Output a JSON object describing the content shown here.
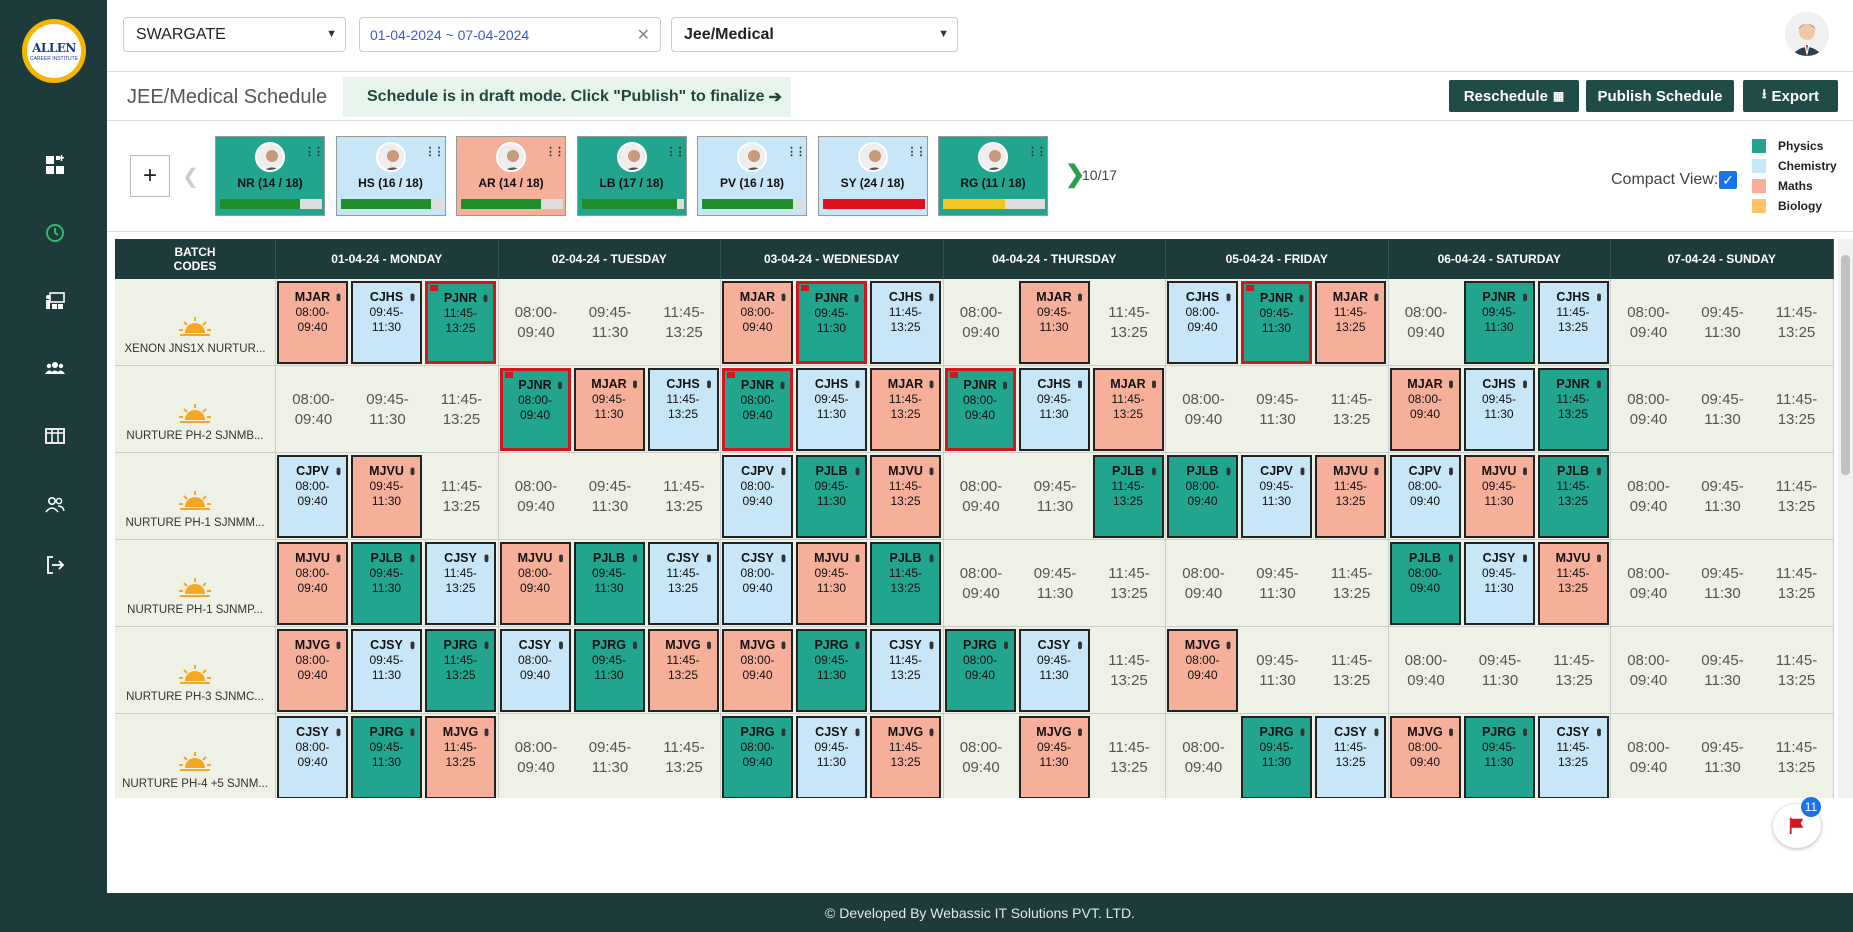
{
  "brand": {
    "logo_text": "ALLEN",
    "logo_sub": "CAREER INSTITUTE"
  },
  "sidebar": {
    "items": [
      {
        "name": "dashboard-icon",
        "active": false
      },
      {
        "name": "clock-icon",
        "active": true
      },
      {
        "name": "classroom-icon",
        "active": false
      },
      {
        "name": "group-icon",
        "active": false
      },
      {
        "name": "calendar-grid-icon",
        "active": false
      },
      {
        "name": "users-icon",
        "active": false
      },
      {
        "name": "logout-icon",
        "active": false
      }
    ]
  },
  "filters": {
    "center": "SWARGATE",
    "date_range": "01-04-2024 ~ 07-04-2024",
    "stream": "Jee/Medical"
  },
  "header": {
    "title": "JEE/Medical Schedule",
    "banner": "Schedule is in draft mode. Click \"Publish\" to finalize",
    "reschedule_label": "Reschedule",
    "publish_label": "Publish Schedule",
    "export_label": "Export"
  },
  "teachers": [
    {
      "initials": "NR",
      "count": "(14 / 18)",
      "subject": "Physics",
      "progress": 0.78,
      "bar_color": "#1e8f2a"
    },
    {
      "initials": "HS",
      "count": "(16 / 18)",
      "subject": "Chemistry",
      "progress": 0.89,
      "bar_color": "#1e8f2a"
    },
    {
      "initials": "AR",
      "count": "(14 / 18)",
      "subject": "Maths",
      "progress": 0.78,
      "bar_color": "#1e8f2a"
    },
    {
      "initials": "LB",
      "count": "(17 / 18)",
      "subject": "Physics",
      "progress": 0.94,
      "bar_color": "#1e8f2a"
    },
    {
      "initials": "PV",
      "count": "(16 / 18)",
      "subject": "Chemistry",
      "progress": 0.89,
      "bar_color": "#1e8f2a"
    },
    {
      "initials": "SY",
      "count": "(24 / 18)",
      "subject": "Chemistry",
      "progress": 1.0,
      "bar_color": "#e0111b"
    },
    {
      "initials": "RG",
      "count": "(11 / 18)",
      "subject": "Physics",
      "progress": 0.61,
      "bar_color": "#f3c623"
    }
  ],
  "pagination": {
    "text": "10/17"
  },
  "compact": {
    "label": "Compact View:",
    "checked": true
  },
  "legend": [
    {
      "label": "Physics",
      "color": "#22a58f"
    },
    {
      "label": "Chemistry",
      "color": "#c7e6f7"
    },
    {
      "label": "Maths",
      "color": "#f6b09a"
    },
    {
      "label": "Biology",
      "color": "#fcc36b"
    }
  ],
  "schedule": {
    "batch_header": "BATCH\nCODES",
    "days": [
      "01-04-24 - MONDAY",
      "02-04-24 - TUESDAY",
      "03-04-24 - WEDNESDAY",
      "04-04-24 - THURSDAY",
      "05-04-24 - FRIDAY",
      "06-04-24 - SATURDAY",
      "07-04-24 - SUNDAY"
    ],
    "slot_times": [
      "08:00-\n09:40",
      "09:45-\n11:30",
      "11:45-\n13:25"
    ],
    "batches": [
      {
        "name": "XENON JNS1X NURTUR...",
        "cells": [
          [
            [
              "MJAR",
              "Maths",
              0
            ],
            [
              "CJHS",
              "Chemistry",
              0
            ],
            [
              "PJNR",
              "Physics",
              1
            ]
          ],
          [
            null,
            null,
            null
          ],
          [
            [
              "MJAR",
              "Maths",
              0
            ],
            [
              "PJNR",
              "Physics",
              1
            ],
            [
              "CJHS",
              "Chemistry",
              0
            ]
          ],
          [
            null,
            [
              "MJAR",
              "Maths",
              0
            ],
            null
          ],
          [
            [
              "CJHS",
              "Chemistry",
              0
            ],
            [
              "PJNR",
              "Physics",
              1
            ],
            [
              "MJAR",
              "Maths",
              0
            ]
          ],
          [
            null,
            [
              "PJNR",
              "Physics",
              0
            ],
            [
              "CJHS",
              "Chemistry",
              0
            ]
          ],
          [
            null,
            null,
            null
          ]
        ]
      },
      {
        "name": "NURTURE PH-2 SJNMB...",
        "cells": [
          [
            null,
            null,
            null
          ],
          [
            [
              "PJNR",
              "Physics",
              1
            ],
            [
              "MJAR",
              "Maths",
              0
            ],
            [
              "CJHS",
              "Chemistry",
              0
            ]
          ],
          [
            [
              "PJNR",
              "Physics",
              1
            ],
            [
              "CJHS",
              "Chemistry",
              0
            ],
            [
              "MJAR",
              "Maths",
              0
            ]
          ],
          [
            [
              "PJNR",
              "Physics",
              1
            ],
            [
              "CJHS",
              "Chemistry",
              0
            ],
            [
              "MJAR",
              "Maths",
              0
            ]
          ],
          [
            null,
            null,
            null
          ],
          [
            [
              "MJAR",
              "Maths",
              0
            ],
            [
              "CJHS",
              "Chemistry",
              0
            ],
            [
              "PJNR",
              "Physics",
              0
            ]
          ],
          [
            null,
            null,
            null
          ]
        ]
      },
      {
        "name": "NURTURE PH-1 SJNMM...",
        "cells": [
          [
            [
              "CJPV",
              "Chemistry",
              0
            ],
            [
              "MJVU",
              "Maths",
              0
            ],
            null
          ],
          [
            null,
            null,
            null
          ],
          [
            [
              "CJPV",
              "Chemistry",
              0
            ],
            [
              "PJLB",
              "Physics",
              0
            ],
            [
              "MJVU",
              "Maths",
              0
            ]
          ],
          [
            null,
            null,
            [
              "PJLB",
              "Physics",
              0
            ]
          ],
          [
            [
              "PJLB",
              "Physics",
              0
            ],
            [
              "CJPV",
              "Chemistry",
              0
            ],
            [
              "MJVU",
              "Maths",
              0
            ]
          ],
          [
            [
              "CJPV",
              "Chemistry",
              0
            ],
            [
              "MJVU",
              "Maths",
              0
            ],
            [
              "PJLB",
              "Physics",
              0
            ]
          ],
          [
            null,
            null,
            null
          ]
        ]
      },
      {
        "name": "NURTURE PH-1 SJNMP...",
        "cells": [
          [
            [
              "MJVU",
              "Maths",
              0
            ],
            [
              "PJLB",
              "Physics",
              0
            ],
            [
              "CJSY",
              "Chemistry",
              0
            ]
          ],
          [
            [
              "MJVU",
              "Maths",
              0
            ],
            [
              "PJLB",
              "Physics",
              0
            ],
            [
              "CJSY",
              "Chemistry",
              0
            ]
          ],
          [
            [
              "CJSY",
              "Chemistry",
              0
            ],
            [
              "MJVU",
              "Maths",
              0
            ],
            [
              "PJLB",
              "Physics",
              0
            ]
          ],
          [
            null,
            null,
            null
          ],
          [
            null,
            null,
            null
          ],
          [
            [
              "PJLB",
              "Physics",
              0
            ],
            [
              "CJSY",
              "Chemistry",
              0
            ],
            [
              "MJVU",
              "Maths",
              0
            ]
          ],
          [
            null,
            null,
            null
          ]
        ]
      },
      {
        "name": "NURTURE PH-3 SJNMC...",
        "cells": [
          [
            [
              "MJVG",
              "Maths",
              0
            ],
            [
              "CJSY",
              "Chemistry",
              0
            ],
            [
              "PJRG",
              "Physics",
              0
            ]
          ],
          [
            [
              "CJSY",
              "Chemistry",
              0
            ],
            [
              "PJRG",
              "Physics",
              0
            ],
            [
              "MJVG",
              "Maths",
              0
            ]
          ],
          [
            [
              "MJVG",
              "Maths",
              0
            ],
            [
              "PJRG",
              "Physics",
              0
            ],
            [
              "CJSY",
              "Chemistry",
              0
            ]
          ],
          [
            [
              "PJRG",
              "Physics",
              0
            ],
            [
              "CJSY",
              "Chemistry",
              0
            ],
            null
          ],
          [
            [
              "MJVG",
              "Maths",
              0
            ],
            null,
            null
          ],
          [
            null,
            null,
            null
          ],
          [
            null,
            null,
            null
          ]
        ]
      },
      {
        "name": "NURTURE PH-4 +5 SJNM...",
        "cells": [
          [
            [
              "CJSY",
              "Chemistry",
              0
            ],
            [
              "PJRG",
              "Physics",
              0
            ],
            [
              "MJVG",
              "Maths",
              0
            ]
          ],
          [
            null,
            null,
            null
          ],
          [
            [
              "PJRG",
              "Physics",
              0
            ],
            [
              "CJSY",
              "Chemistry",
              0
            ],
            [
              "MJVG",
              "Maths",
              0
            ]
          ],
          [
            null,
            [
              "MJVG",
              "Maths",
              0
            ],
            null
          ],
          [
            null,
            [
              "PJRG",
              "Physics",
              0
            ],
            [
              "CJSY",
              "Chemistry",
              0
            ]
          ],
          [
            [
              "MJVG",
              "Maths",
              0
            ],
            [
              "PJRG",
              "Physics",
              0
            ],
            [
              "CJSY",
              "Chemistry",
              0
            ]
          ],
          [
            null,
            null,
            null
          ]
        ]
      }
    ]
  },
  "flag_badge": "11",
  "footer": {
    "text": "© Developed By Webassic IT Solutions PVT. LTD."
  }
}
